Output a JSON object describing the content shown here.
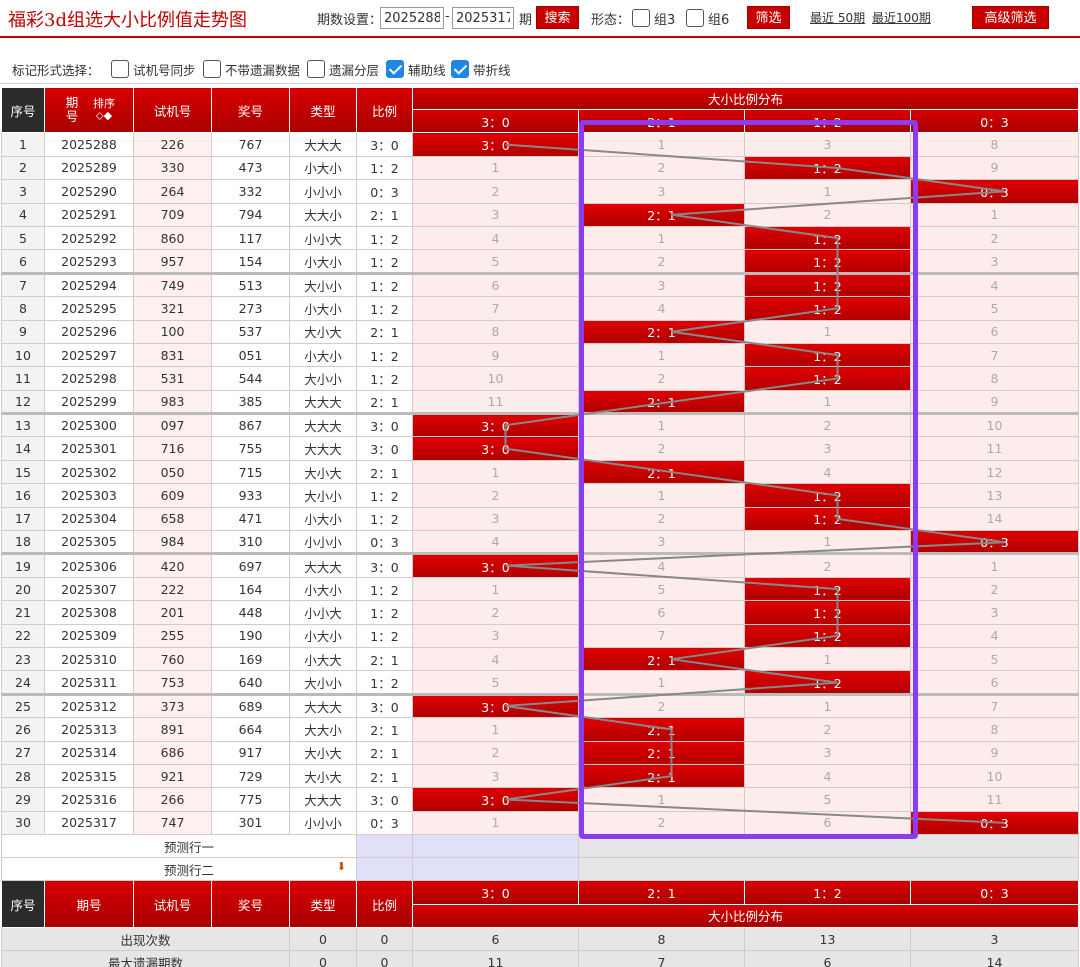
{
  "header": {
    "title": "福彩3d组选大小比例值走势图",
    "period_label": "期数设置：",
    "period_from": "2025288",
    "dash": "-",
    "period_to": "2025317",
    "period_unit": "期",
    "search_label": "搜索",
    "form_label": "形态：",
    "group3_label": "组3",
    "group6_label": "组6",
    "filter_label": "筛选",
    "recent50_label": "最近 50期",
    "recent100_label": "最近100期",
    "advanced_label": "高级筛选"
  },
  "options": {
    "label": "标记形式选择：",
    "items": [
      {
        "label": "试机号同步",
        "checked": false
      },
      {
        "label": "不带遗漏数据",
        "checked": false
      },
      {
        "label": "遗漏分层",
        "checked": false
      },
      {
        "label": "辅助线",
        "checked": true
      },
      {
        "label": "带折线",
        "checked": true
      }
    ]
  },
  "table": {
    "columns": {
      "seq": "序号",
      "period": "期号",
      "sort": "排序",
      "trial": "试机号",
      "prize": "奖号",
      "type": "类型",
      "ratio": "比例",
      "dist": "大小比例分布"
    },
    "dist_cols": [
      "3：0",
      "2：1",
      "1：2",
      "0：3"
    ],
    "rows": [
      {
        "seq": "1",
        "period": "2025288",
        "trial": "226",
        "prize": "767",
        "type": "大大大",
        "ratio": "3：0",
        "dist": [
          "3：0",
          "1",
          "3",
          "8"
        ],
        "hit": 0
      },
      {
        "seq": "2",
        "period": "2025289",
        "trial": "330",
        "prize": "473",
        "type": "小大小",
        "ratio": "1：2",
        "dist": [
          "1",
          "2",
          "1：2",
          "9"
        ],
        "hit": 2
      },
      {
        "seq": "3",
        "period": "2025290",
        "trial": "264",
        "prize": "332",
        "type": "小小小",
        "ratio": "0：3",
        "dist": [
          "2",
          "3",
          "1",
          "0：3"
        ],
        "hit": 3
      },
      {
        "seq": "4",
        "period": "2025291",
        "trial": "709",
        "prize": "794",
        "type": "大大小",
        "ratio": "2：1",
        "dist": [
          "3",
          "2：1",
          "2",
          "1"
        ],
        "hit": 1
      },
      {
        "seq": "5",
        "period": "2025292",
        "trial": "860",
        "prize": "117",
        "type": "小小大",
        "ratio": "1：2",
        "dist": [
          "4",
          "1",
          "1：2",
          "2"
        ],
        "hit": 2
      },
      {
        "seq": "6",
        "period": "2025293",
        "trial": "957",
        "prize": "154",
        "type": "小大小",
        "ratio": "1：2",
        "dist": [
          "5",
          "2",
          "1：2",
          "3"
        ],
        "hit": 2
      },
      {
        "seq": "7",
        "period": "2025294",
        "trial": "749",
        "prize": "513",
        "type": "大小小",
        "ratio": "1：2",
        "dist": [
          "6",
          "3",
          "1：2",
          "4"
        ],
        "hit": 2
      },
      {
        "seq": "8",
        "period": "2025295",
        "trial": "321",
        "prize": "273",
        "type": "小大小",
        "ratio": "1：2",
        "dist": [
          "7",
          "4",
          "1：2",
          "5"
        ],
        "hit": 2
      },
      {
        "seq": "9",
        "period": "2025296",
        "trial": "100",
        "prize": "537",
        "type": "大小大",
        "ratio": "2：1",
        "dist": [
          "8",
          "2：1",
          "1",
          "6"
        ],
        "hit": 1
      },
      {
        "seq": "10",
        "period": "2025297",
        "trial": "831",
        "prize": "051",
        "type": "小大小",
        "ratio": "1：2",
        "dist": [
          "9",
          "1",
          "1：2",
          "7"
        ],
        "hit": 2
      },
      {
        "seq": "11",
        "period": "2025298",
        "trial": "531",
        "prize": "544",
        "type": "大小小",
        "ratio": "1：2",
        "dist": [
          "10",
          "2",
          "1：2",
          "8"
        ],
        "hit": 2
      },
      {
        "seq": "12",
        "period": "2025299",
        "trial": "983",
        "prize": "385",
        "type": "大大大",
        "ratio": "2：1",
        "dist": [
          "11",
          "2：1",
          "1",
          "9"
        ],
        "hit": 1
      },
      {
        "seq": "13",
        "period": "2025300",
        "trial": "097",
        "prize": "867",
        "type": "大大大",
        "ratio": "3：0",
        "dist": [
          "3：0",
          "1",
          "2",
          "10"
        ],
        "hit": 0
      },
      {
        "seq": "14",
        "period": "2025301",
        "trial": "716",
        "prize": "755",
        "type": "大大大",
        "ratio": "3：0",
        "dist": [
          "3：0",
          "2",
          "3",
          "11"
        ],
        "hit": 0
      },
      {
        "seq": "15",
        "period": "2025302",
        "trial": "050",
        "prize": "715",
        "type": "大小大",
        "ratio": "2：1",
        "dist": [
          "1",
          "2：1",
          "4",
          "12"
        ],
        "hit": 1
      },
      {
        "seq": "16",
        "period": "2025303",
        "trial": "609",
        "prize": "933",
        "type": "大小小",
        "ratio": "1：2",
        "dist": [
          "2",
          "1",
          "1：2",
          "13"
        ],
        "hit": 2
      },
      {
        "seq": "17",
        "period": "2025304",
        "trial": "658",
        "prize": "471",
        "type": "小大小",
        "ratio": "1：2",
        "dist": [
          "3",
          "2",
          "1：2",
          "14"
        ],
        "hit": 2
      },
      {
        "seq": "18",
        "period": "2025305",
        "trial": "984",
        "prize": "310",
        "type": "小小小",
        "ratio": "0：3",
        "dist": [
          "4",
          "3",
          "1",
          "0：3"
        ],
        "hit": 3
      },
      {
        "seq": "19",
        "period": "2025306",
        "trial": "420",
        "prize": "697",
        "type": "大大大",
        "ratio": "3：0",
        "dist": [
          "3：0",
          "4",
          "2",
          "1"
        ],
        "hit": 0
      },
      {
        "seq": "20",
        "period": "2025307",
        "trial": "222",
        "prize": "164",
        "type": "小大小",
        "ratio": "1：2",
        "dist": [
          "1",
          "5",
          "1：2",
          "2"
        ],
        "hit": 2
      },
      {
        "seq": "21",
        "period": "2025308",
        "trial": "201",
        "prize": "448",
        "type": "小小大",
        "ratio": "1：2",
        "dist": [
          "2",
          "6",
          "1：2",
          "3"
        ],
        "hit": 2
      },
      {
        "seq": "22",
        "period": "2025309",
        "trial": "255",
        "prize": "190",
        "type": "小大小",
        "ratio": "1：2",
        "dist": [
          "3",
          "7",
          "1：2",
          "4"
        ],
        "hit": 2
      },
      {
        "seq": "23",
        "period": "2025310",
        "trial": "760",
        "prize": "169",
        "type": "小大大",
        "ratio": "2：1",
        "dist": [
          "4",
          "2：1",
          "1",
          "5"
        ],
        "hit": 1
      },
      {
        "seq": "24",
        "period": "2025311",
        "trial": "753",
        "prize": "640",
        "type": "大小小",
        "ratio": "1：2",
        "dist": [
          "5",
          "1",
          "1：2",
          "6"
        ],
        "hit": 2
      },
      {
        "seq": "25",
        "period": "2025312",
        "trial": "373",
        "prize": "689",
        "type": "大大大",
        "ratio": "3：0",
        "dist": [
          "3：0",
          "2",
          "1",
          "7"
        ],
        "hit": 0
      },
      {
        "seq": "26",
        "period": "2025313",
        "trial": "891",
        "prize": "664",
        "type": "大大小",
        "ratio": "2：1",
        "dist": [
          "1",
          "2：1",
          "2",
          "8"
        ],
        "hit": 1
      },
      {
        "seq": "27",
        "period": "2025314",
        "trial": "686",
        "prize": "917",
        "type": "大小大",
        "ratio": "2：1",
        "dist": [
          "2",
          "2：1",
          "3",
          "9"
        ],
        "hit": 1
      },
      {
        "seq": "28",
        "period": "2025315",
        "trial": "921",
        "prize": "729",
        "type": "大小大",
        "ratio": "2：1",
        "dist": [
          "3",
          "2：1",
          "4",
          "10"
        ],
        "hit": 1
      },
      {
        "seq": "29",
        "period": "2025316",
        "trial": "266",
        "prize": "775",
        "type": "大大大",
        "ratio": "3：0",
        "dist": [
          "3：0",
          "1",
          "5",
          "11"
        ],
        "hit": 0
      },
      {
        "seq": "30",
        "period": "2025317",
        "trial": "747",
        "prize": "301",
        "type": "小小小",
        "ratio": "0：3",
        "dist": [
          "1",
          "2",
          "6",
          "0：3"
        ],
        "hit": 3
      }
    ],
    "predict1": "预测行一",
    "predict2": "预测行二",
    "stats": [
      {
        "label": "出现次数",
        "type": "0",
        "ratio": "0",
        "dist": [
          "6",
          "8",
          "13",
          "3"
        ]
      },
      {
        "label": "最大遗漏期数",
        "type": "0",
        "ratio": "0",
        "dist": [
          "11",
          "7",
          "6",
          "14"
        ]
      }
    ]
  },
  "colors": {
    "accent": "#c80000",
    "highlight_box": "#8b3bf0",
    "checkbox_on": "#1e88e5"
  }
}
